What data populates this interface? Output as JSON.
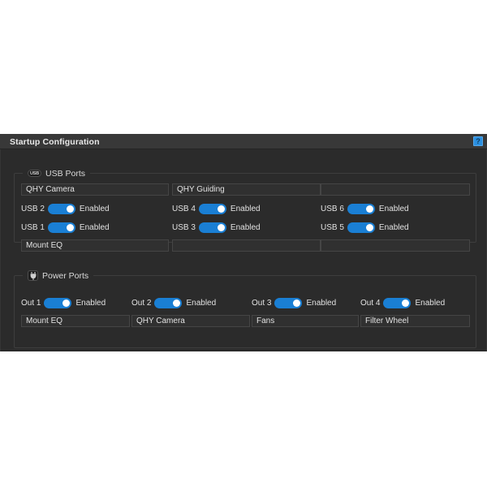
{
  "window": {
    "title": "Startup Configuration",
    "help_icon": "help-question-icon",
    "help_label": "?",
    "accent_color": "#1a7fd4",
    "background_color": "#2b2b2b",
    "titlebar_color": "#383838"
  },
  "groups": [
    {
      "id": "usb-ports",
      "label": "USB Ports",
      "icon": "usb-icon",
      "icon_text": "USB",
      "top_fields": [
        {
          "name": "usb-top-field-1",
          "value": "QHY Camera"
        },
        {
          "name": "usb-top-field-2",
          "value": "QHY Guiding"
        },
        {
          "name": "usb-top-field-3",
          "value": ""
        }
      ],
      "toggles_upper": [
        {
          "name": "usb-2",
          "label": "USB 2",
          "state": "Enabled",
          "on": true
        },
        {
          "name": "usb-4",
          "label": "USB 4",
          "state": "Enabled",
          "on": true
        },
        {
          "name": "usb-6",
          "label": "USB 6",
          "state": "Enabled",
          "on": true
        }
      ],
      "toggles_lower": [
        {
          "name": "usb-1",
          "label": "USB 1",
          "state": "Enabled",
          "on": true
        },
        {
          "name": "usb-3",
          "label": "USB 3",
          "state": "Enabled",
          "on": true
        },
        {
          "name": "usb-5",
          "label": "USB 5",
          "state": "Enabled",
          "on": true
        }
      ],
      "bottom_fields": [
        {
          "name": "usb-bottom-field-1",
          "value": "Mount EQ"
        },
        {
          "name": "usb-bottom-field-2",
          "value": ""
        },
        {
          "name": "usb-bottom-field-3",
          "value": ""
        }
      ]
    },
    {
      "id": "power-ports",
      "label": "Power Ports",
      "icon": "power-plug-icon",
      "toggles": [
        {
          "name": "out-1",
          "label": "Out 1",
          "state": "Enabled",
          "on": true
        },
        {
          "name": "out-2",
          "label": "Out 2",
          "state": "Enabled",
          "on": true
        },
        {
          "name": "out-3",
          "label": "Out 3",
          "state": "Enabled",
          "on": true
        },
        {
          "name": "out-4",
          "label": "Out 4",
          "state": "Enabled",
          "on": true
        }
      ],
      "fields": [
        {
          "name": "power-field-1",
          "value": "Mount EQ"
        },
        {
          "name": "power-field-2",
          "value": "QHY Camera"
        },
        {
          "name": "power-field-3",
          "value": "Fans"
        },
        {
          "name": "power-field-4",
          "value": "Filter Wheel"
        }
      ]
    }
  ]
}
